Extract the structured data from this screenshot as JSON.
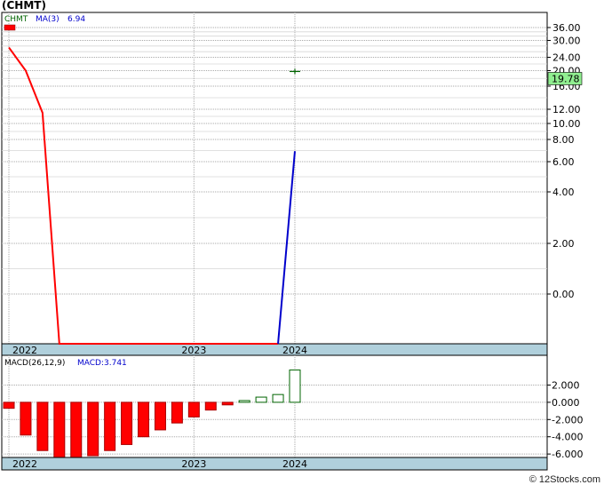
{
  "title": "(CHMT)",
  "watermark": "© 12Stocks.com",
  "colors": {
    "price_line": "#ff0000",
    "ma_line": "#0000cc",
    "macd_negative": "#ff0000",
    "macd_positive": "#006400",
    "axis_band": "#b0d0dc",
    "grid": "#aaaaaa",
    "price_badge": "#90ee90",
    "legend_ticker": "#006400",
    "legend_ma": "#0000cc"
  },
  "chart_data": [
    {
      "type": "line",
      "legend": {
        "ticker": "CHMT",
        "ma_label": "MA(3)",
        "ma_value": "6.94"
      },
      "scale": "log",
      "x_labels": [
        {
          "label": "2022",
          "x": 0
        },
        {
          "label": "2023",
          "x": 11
        },
        {
          "label": "2024",
          "x": 17
        }
      ],
      "y_ticks": [
        "36.00",
        "30.00",
        "24.00",
        "20.00",
        "16.00",
        "12.00",
        "10.00",
        "8.00",
        "6.00",
        "4.00",
        "2.00",
        "0.00"
      ],
      "last_price": "19.78",
      "series": [
        {
          "name": "CHMT",
          "x": [
            0,
            1,
            2,
            3,
            4,
            5,
            6,
            7,
            8,
            9,
            10,
            11,
            12,
            13,
            14,
            15,
            16
          ],
          "values": [
            27.5,
            20.0,
            11.5,
            "below",
            "below",
            "below",
            "below",
            "below",
            "below",
            "below",
            "below",
            "below",
            "below",
            "below",
            "below",
            "below",
            "below"
          ]
        },
        {
          "name": "MA(3)",
          "x": [
            16,
            17
          ],
          "values": [
            "below",
            6.94
          ]
        }
      ],
      "last_point": {
        "x": 17,
        "value": 19.78
      }
    },
    {
      "type": "bar",
      "legend": {
        "label": "MACD(26,12,9)",
        "macd_label": "MACD:3.741"
      },
      "x_labels": [
        {
          "label": "2022",
          "x": 1
        },
        {
          "label": "2023",
          "x": 11
        },
        {
          "label": "2024",
          "x": 17
        }
      ],
      "y_ticks": [
        "2.000",
        "0.000",
        "-2.000",
        "-4.000",
        "-6.000"
      ],
      "ylim": [
        -6.4,
        3.8
      ],
      "x": [
        0,
        1,
        2,
        3,
        4,
        5,
        6,
        7,
        8,
        9,
        10,
        11,
        12,
        13,
        14,
        15,
        16,
        17
      ],
      "values": [
        -0.7,
        -3.8,
        -5.6,
        -6.4,
        -6.4,
        -6.2,
        -5.6,
        -4.9,
        -4.0,
        -3.2,
        -2.4,
        -1.7,
        -0.9,
        -0.3,
        0.2,
        0.6,
        0.9,
        3.741
      ]
    }
  ]
}
